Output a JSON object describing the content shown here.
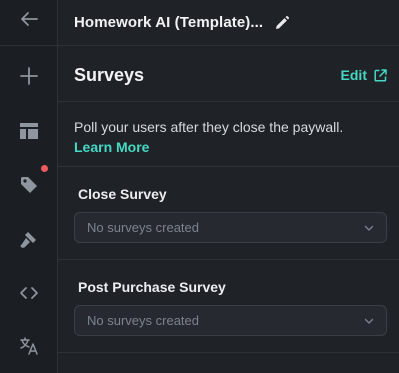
{
  "header": {
    "project_title": "Homework AI (Template)..."
  },
  "sidebar": {
    "icons": [
      "back-arrow-icon",
      "plus-icon",
      "layout-icon",
      "tag-icon",
      "brush-icon",
      "code-icon",
      "translate-icon"
    ],
    "notification_color": "#ef5b5b"
  },
  "section": {
    "title": "Surveys",
    "edit_label": "Edit",
    "description": "Poll your users after they close the paywall.",
    "learn_more_label": "Learn More"
  },
  "surveys": [
    {
      "label": "Close Survey",
      "selected": "No surveys created"
    },
    {
      "label": "Post Purchase Survey",
      "selected": "No surveys created"
    }
  ],
  "colors": {
    "accent": "#45d9c4",
    "background": "#1f2227",
    "rail": "#1b1e23"
  }
}
